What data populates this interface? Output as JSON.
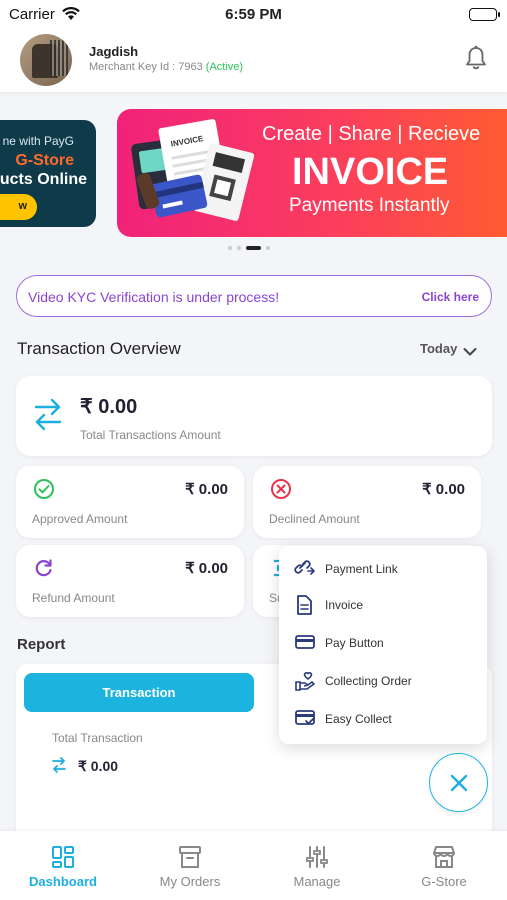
{
  "status_bar": {
    "carrier": "Carrier",
    "time": "6:59 PM"
  },
  "header": {
    "name": "Jagdish",
    "merchant_key_prefix": "Merchant Key Id : 7963",
    "status": "(Active)"
  },
  "banners": {
    "left": {
      "line1": "ne with PayG",
      "line2": "G-Store",
      "line3": "ucts Online",
      "button": "w"
    },
    "main": {
      "line1": "Create | Share | Recieve",
      "line2": "INVOICE",
      "line3": "Payments Instantly",
      "illustration_label": "INVOICE"
    },
    "page_count": 4,
    "active_page": 3
  },
  "kyc": {
    "message": "Video KYC Verification is under process!",
    "link": "Click here"
  },
  "overview": {
    "title": "Transaction Overview",
    "filter": "Today",
    "total": {
      "amount": "₹ 0.00",
      "label": "Total Transactions Amount"
    },
    "approved": {
      "amount": "₹ 0.00",
      "label": "Approved Amount"
    },
    "declined": {
      "amount": "₹ 0.00",
      "label": "Declined Amount"
    },
    "refund": {
      "amount": "₹ 0.00",
      "label": "Refund Amount"
    },
    "settled": {
      "label": "Su"
    }
  },
  "report": {
    "title": "Report",
    "tab": "Transaction",
    "total_label": "Total Transaction",
    "total_amount": "₹ 0.00"
  },
  "menu": {
    "items": [
      {
        "label": "Payment Link",
        "icon": "payment-link-icon"
      },
      {
        "label": "Invoice",
        "icon": "invoice-icon"
      },
      {
        "label": "Pay Button",
        "icon": "pay-button-icon"
      },
      {
        "label": "Collecting Order",
        "icon": "collecting-order-icon"
      },
      {
        "label": "Easy Collect",
        "icon": "easy-collect-icon"
      }
    ]
  },
  "bottom_nav": {
    "items": [
      {
        "label": "Dashboard",
        "icon": "dashboard-icon",
        "active": true
      },
      {
        "label": "My Orders",
        "icon": "orders-icon"
      },
      {
        "label": "Manage",
        "icon": "manage-icon"
      },
      {
        "label": "G-Store",
        "icon": "store-icon"
      }
    ]
  },
  "colors": {
    "accent": "#1eaee0",
    "kyc_purple": "#8a44d0",
    "approved_green": "#2ec15b",
    "declined_red": "#e8344a",
    "refund_purple": "#8a44d0"
  }
}
